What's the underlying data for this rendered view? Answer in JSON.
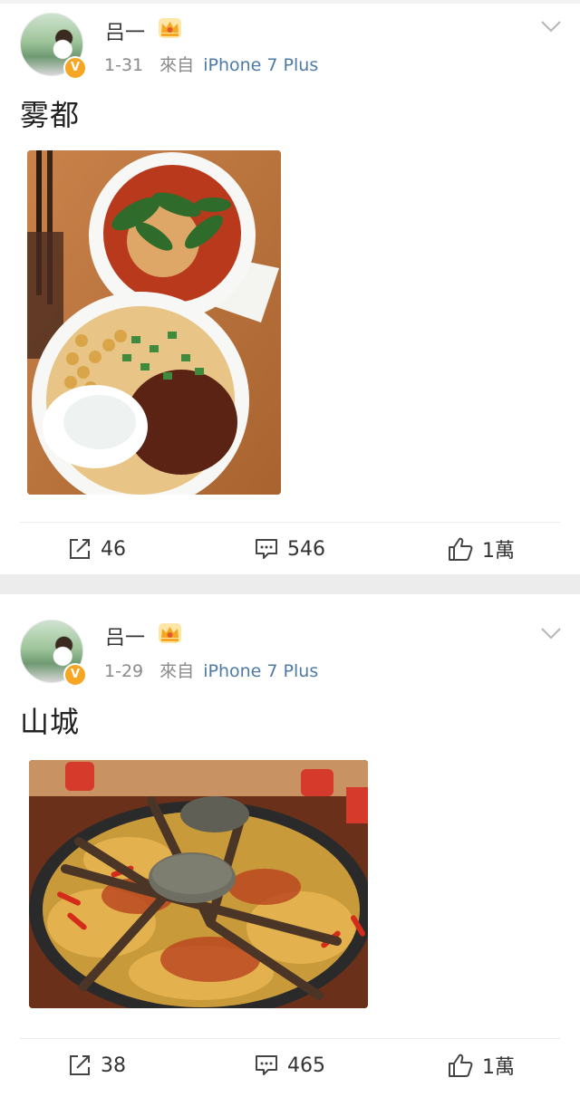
{
  "posts": [
    {
      "username": "吕一",
      "date": "1-31",
      "source_prefix": "來自",
      "source_device": "iPhone 7 Plus",
      "text": "雾都",
      "repost_count": "46",
      "comment_count": "546",
      "like_count": "1萬"
    },
    {
      "username": "吕一",
      "date": "1-29",
      "source_prefix": "來自",
      "source_device": "iPhone 7 Plus",
      "text": "山城",
      "repost_count": "38",
      "comment_count": "465",
      "like_count": "1萬"
    }
  ],
  "icons": {
    "verified": "V",
    "crown": "crown-icon",
    "more": "chevron-down-icon",
    "repost": "repost-icon",
    "comment": "comment-icon",
    "like": "thumbs-up-icon"
  },
  "colors": {
    "source_link": "#4e7aa6",
    "verified_badge": "#f6a623",
    "crown": "#f5a623",
    "separator": "#ececec"
  }
}
